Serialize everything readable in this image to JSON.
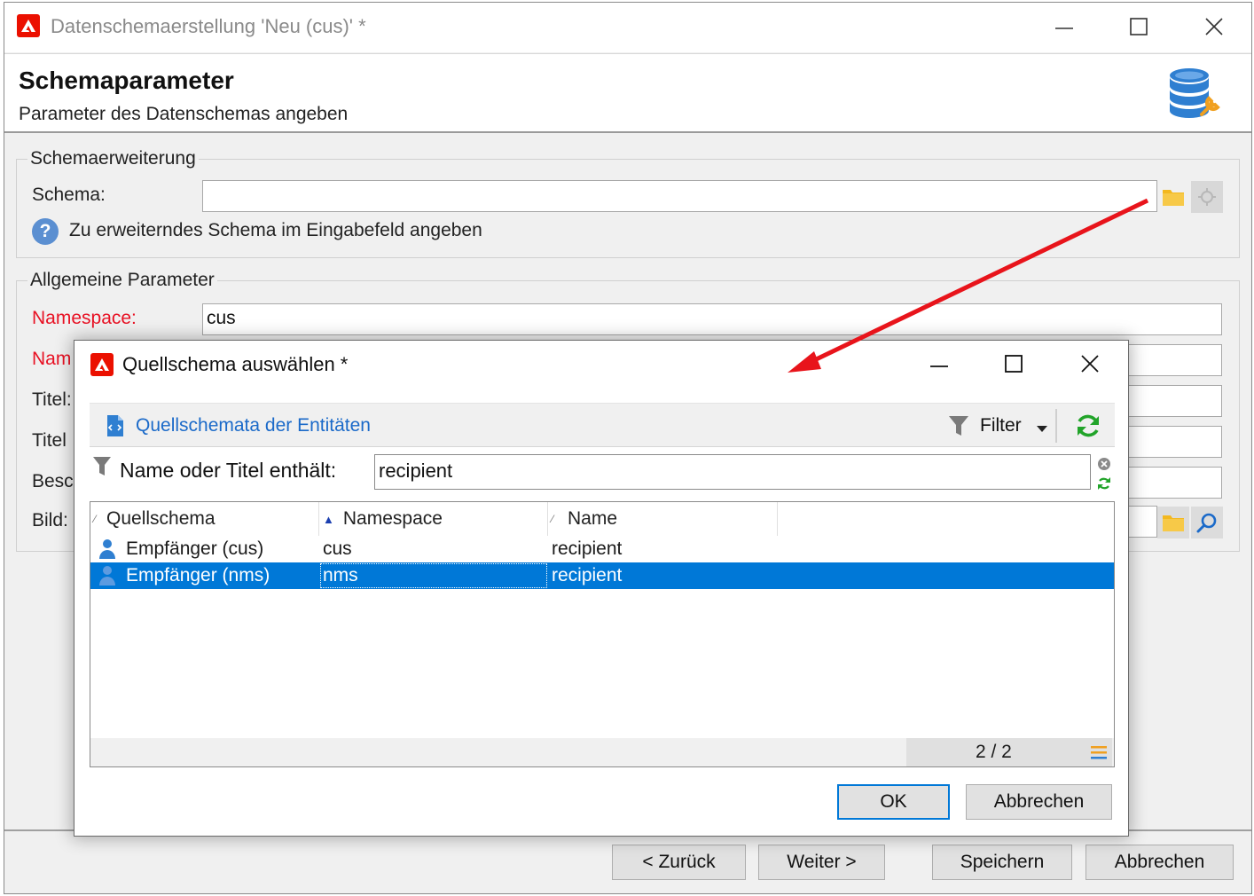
{
  "main_window": {
    "title": "Datenschemaerstellung 'Neu (cus)' *",
    "header": {
      "title": "Schemaparameter",
      "subtitle": "Parameter des Datenschemas angeben"
    },
    "schema_extension": {
      "legend": "Schemaerweiterung",
      "schema_label": "Schema:",
      "schema_value": "",
      "hint": "Zu erweiterndes Schema im Eingabefeld angeben"
    },
    "general": {
      "legend": "Allgemeine Parameter",
      "namespace_label": "Namespace:",
      "namespace_value": "cus",
      "name_label": "Nam",
      "title_label": "Titel:",
      "title_plural_label": "Titel",
      "description_label": "Besc",
      "image_label": "Bild:"
    },
    "buttons": {
      "back": "< Zurück",
      "next": "Weiter >",
      "save": "Speichern",
      "cancel": "Abbrechen"
    }
  },
  "dialog": {
    "title": "Quellschema auswählen *",
    "toolbar": {
      "folder_label": "Quellschemata der Entitäten",
      "filter_label": "Filter"
    },
    "filter": {
      "label": "Name oder Titel enthält:",
      "value": "recipient"
    },
    "columns": [
      "Quellschema",
      "Namespace",
      "Name"
    ],
    "rows": [
      {
        "schema": "Empfänger (cus)",
        "namespace": "cus",
        "name": "recipient",
        "selected": false
      },
      {
        "schema": "Empfänger (nms)",
        "namespace": "nms",
        "name": "recipient",
        "selected": true
      }
    ],
    "count": "2 / 2",
    "buttons": {
      "ok": "OK",
      "cancel": "Abbrechen"
    }
  },
  "colors": {
    "selection": "#0078d7",
    "required_label": "#e81123",
    "link": "#1b6ac9",
    "annotation_arrow": "#e8141b",
    "brand": "#eb1000"
  },
  "icons": [
    "adobe-logo-icon",
    "database-wrench-icon",
    "folder-icon",
    "help-icon",
    "person-icon",
    "filter-icon",
    "refresh-icon",
    "magnifier-icon",
    "schema-document-icon"
  ]
}
